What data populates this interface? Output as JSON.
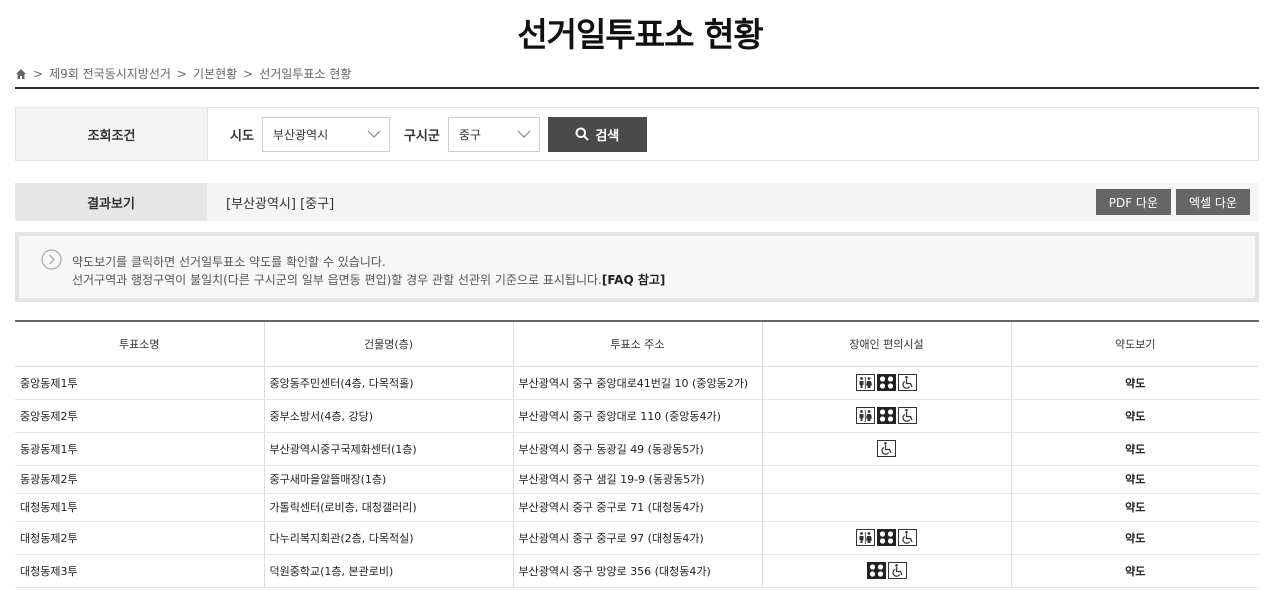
{
  "page_title": "선거일투표소 현황",
  "breadcrumb": {
    "items": [
      "제9회 전국동시지방선거",
      "기본현황",
      "선거일투표소 현황"
    ],
    "separator": ">"
  },
  "search": {
    "label": "조회조건",
    "sido_label": "시도",
    "sido_value": "부산광역시",
    "gu_label": "구시군",
    "gu_value": "중구",
    "button_label": "검색"
  },
  "result": {
    "label": "결과보기",
    "summary": "[부산광역시] [중구]",
    "pdf_button": "PDF 다운",
    "excel_button": "엑셀 다운"
  },
  "notice": {
    "line1": "약도보기를 클릭하면 선거일투표소 약도를 확인할 수 있습니다.",
    "line2": "선거구역과 행정구역이 불일치(다른 구시군의 일부 읍면동 편입)할 경우 관할 선관위 기준으로 표시됩니다.",
    "faq": "[FAQ 참고]"
  },
  "table": {
    "headers": [
      "투표소명",
      "건물명(층)",
      "투표소 주소",
      "장애인 편의시설",
      "약도보기"
    ],
    "rows": [
      {
        "name": "중앙동제1투",
        "building": "중앙동주민센터(4층, 다목적홀)",
        "address": "부산광역시 중구 중앙대로41번길 10 (중앙동2가)",
        "facilities": [
          "restroom-icon",
          "braille-block-icon",
          "wheelchair-icon"
        ],
        "map": "약도"
      },
      {
        "name": "중앙동제2투",
        "building": "중부소방서(4층, 강당)",
        "address": "부산광역시 중구 중앙대로 110 (중앙동4가)",
        "facilities": [
          "restroom-icon",
          "braille-block-icon",
          "wheelchair-icon"
        ],
        "map": "약도"
      },
      {
        "name": "동광동제1투",
        "building": "부산광역시중구국제화센터(1층)",
        "address": "부산광역시 중구 동광길 49 (동광동5가)",
        "facilities": [
          "wheelchair-icon"
        ],
        "map": "약도"
      },
      {
        "name": "동광동제2투",
        "building": "중구새마을알뜰매장(1층)",
        "address": "부산광역시 중구 샘길 19-9 (동광동5가)",
        "facilities": [],
        "map": "약도"
      },
      {
        "name": "대청동제1투",
        "building": "가톨릭센터(로비층, 대청갤러리)",
        "address": "부산광역시 중구 중구로 71 (대청동4가)",
        "facilities": [],
        "map": "약도"
      },
      {
        "name": "대청동제2투",
        "building": "다누리복지회관(2층, 다목적실)",
        "address": "부산광역시 중구 중구로 97 (대청동4가)",
        "facilities": [
          "restroom-icon",
          "braille-block-icon",
          "wheelchair-icon"
        ],
        "map": "약도"
      },
      {
        "name": "대청동제3투",
        "building": "덕원중학교(1층, 본관로비)",
        "address": "부산광역시 중구 망양로 356 (대청동4가)",
        "facilities": [
          "braille-block-icon",
          "wheelchair-icon"
        ],
        "map": "약도"
      }
    ]
  },
  "colors": {
    "search_button": "#4a4a4a",
    "download_button": "#666666",
    "label_bg": "#e6e6e6"
  }
}
